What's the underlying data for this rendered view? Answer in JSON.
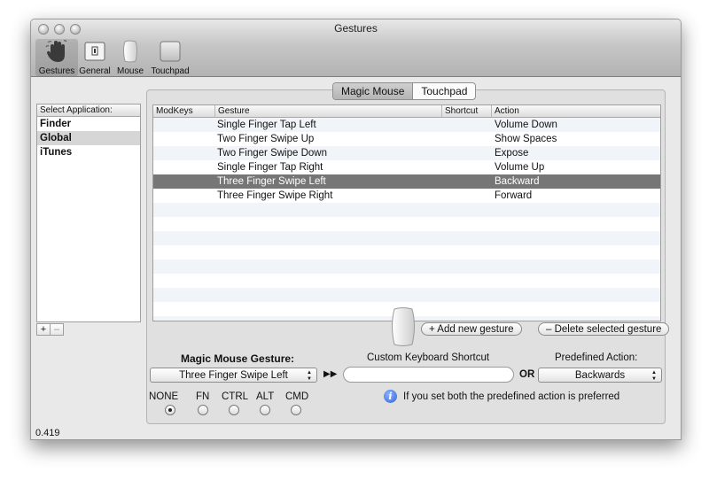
{
  "window": {
    "title": "Gestures"
  },
  "toolbar": {
    "items": [
      {
        "label": "Gestures",
        "icon": "hand-icon"
      },
      {
        "label": "General",
        "icon": "switch-icon"
      },
      {
        "label": "Mouse",
        "icon": "mouse-icon"
      },
      {
        "label": "Touchpad",
        "icon": "touchpad-icon"
      }
    ]
  },
  "apps": {
    "header": "Select Application:",
    "items": [
      "Finder",
      "Global",
      "iTunes"
    ],
    "selected": "Global",
    "add_label": "+",
    "remove_label": "–"
  },
  "device_tabs": [
    "Magic Mouse",
    "Touchpad"
  ],
  "table": {
    "columns": [
      "ModKeys",
      "Gesture",
      "Shortcut",
      "Action"
    ],
    "rows": [
      {
        "modkeys": "",
        "gesture": "Single Finger Tap Left",
        "shortcut": "",
        "action": "Volume Down"
      },
      {
        "modkeys": "",
        "gesture": "Two Finger Swipe Up",
        "shortcut": "",
        "action": "Show Spaces"
      },
      {
        "modkeys": "",
        "gesture": "Two Finger Swipe Down",
        "shortcut": "",
        "action": "Expose"
      },
      {
        "modkeys": "",
        "gesture": "Single Finger Tap Right",
        "shortcut": "",
        "action": "Volume Up"
      },
      {
        "modkeys": "",
        "gesture": "Three Finger Swipe Left",
        "shortcut": "",
        "action": "Backward"
      },
      {
        "modkeys": "",
        "gesture": "Three Finger Swipe Right",
        "shortcut": "",
        "action": "Forward"
      }
    ],
    "selected_index": 4
  },
  "buttons": {
    "add_gesture": "+ Add new gesture",
    "delete_gesture": "– Delete selected gesture"
  },
  "editor": {
    "gesture_label": "Magic Mouse Gesture:",
    "gesture_value": "Three Finger Swipe Left",
    "arrow_symbol": "▶▶",
    "shortcut_label": "Custom Keyboard Shortcut",
    "shortcut_value": "",
    "or_label": "OR",
    "predefined_label": "Predefined Action:",
    "predefined_value": "Backwards",
    "modifiers": [
      "NONE",
      "FN",
      "CTRL",
      "ALT",
      "CMD"
    ],
    "modifier_selected": "NONE",
    "info_text": "If you set both the predefined action is preferred"
  },
  "status": {
    "text": "0.419"
  }
}
